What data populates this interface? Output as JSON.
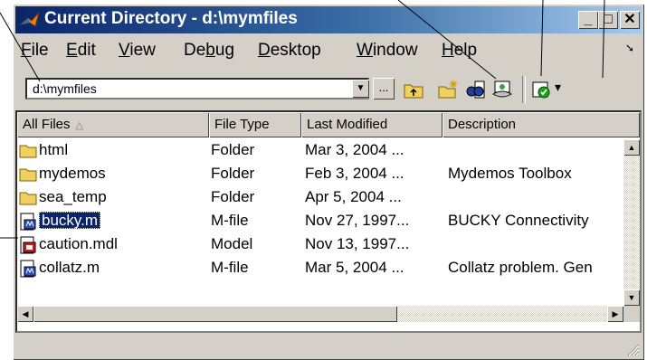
{
  "window": {
    "title": "Current Directory - d:\\mymfiles",
    "minimize_glyph": "_",
    "maximize_glyph": "□",
    "close_glyph": "✕"
  },
  "menu": {
    "items": [
      {
        "underline": "F",
        "rest": "ile"
      },
      {
        "underline": "E",
        "rest": "dit"
      },
      {
        "underline": "V",
        "rest": "iew"
      },
      {
        "pre": "De",
        "underline": "b",
        "rest": "ug"
      },
      {
        "underline": "D",
        "rest": "esktop"
      },
      {
        "underline": "W",
        "rest": "indow"
      },
      {
        "underline": "H",
        "rest": "elp"
      }
    ],
    "overflow_glyph": "➘"
  },
  "toolbar": {
    "path_value": "d:\\mymfiles",
    "combo_glyph": "▼",
    "browse_label": "...",
    "icons": [
      "up-folder-icon",
      "new-file-icon",
      "find-icon",
      "visual-directory-icon",
      "reports-icon"
    ],
    "reports_dropdown_glyph": "▾"
  },
  "filelist": {
    "columns": [
      "All Files",
      "File Type",
      "Last Modified",
      "Description"
    ],
    "sort_indicator": "△",
    "rows": [
      {
        "name": "html",
        "type": "Folder",
        "modified": "Mar 3, 2004 ...",
        "description": "",
        "icon": "folder-icon"
      },
      {
        "name": "mydemos",
        "type": "Folder",
        "modified": "Feb 3, 2004 ...",
        "description": "Mydemos Toolbox",
        "icon": "folder-icon"
      },
      {
        "name": "sea_temp",
        "type": "Folder",
        "modified": "Apr 5, 2004 ...",
        "description": "",
        "icon": "folder-icon"
      },
      {
        "name": "bucky.m",
        "type": "M-file",
        "modified": "Nov 27, 1997...",
        "description": "BUCKY  Connectivity",
        "icon": "mfile-icon",
        "selected": true
      },
      {
        "name": "caution.mdl",
        "type": "Model",
        "modified": "Nov 13, 1997...",
        "description": "",
        "icon": "model-icon"
      },
      {
        "name": "collatz.m",
        "type": "M-file",
        "modified": "Mar 5, 2004 ...",
        "description": "Collatz problem. Gen",
        "icon": "mfile-icon"
      }
    ]
  },
  "colors": {
    "titlebar_start": "#0a246a",
    "titlebar_end": "#a6caf0",
    "face": "#d4d0c8",
    "selection": "#0a246a",
    "folder": "#f0d060"
  }
}
